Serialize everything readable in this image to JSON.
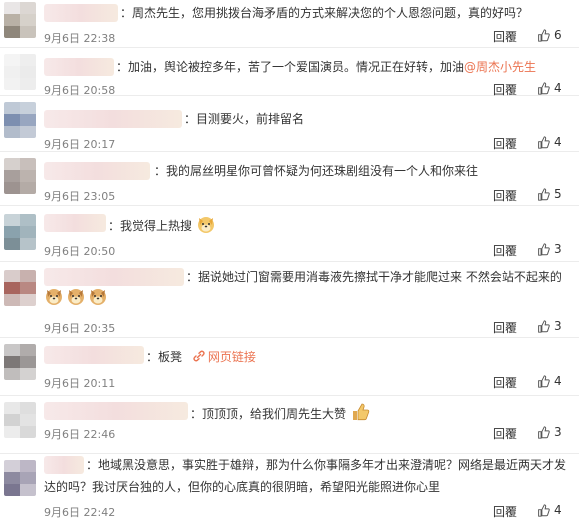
{
  "comments": [
    {
      "text": "：周杰先生，您用挑拨台海矛盾的方式来解决您的个人恩怨问题，真的好吗？",
      "time": "9月6日 22:38",
      "reply": "回覆",
      "likes": "6"
    },
    {
      "text_a": "：加油，舆论被控多年，苦了一个爱国演员。情况正在好转，加油",
      "mention": "@周杰小先生",
      "time": "9月6日 20:58",
      "reply": "回覆",
      "likes": "4"
    },
    {
      "text": "：目测要火，前排留名",
      "time": "9月6日 20:17",
      "reply": "回覆",
      "likes": "4"
    },
    {
      "text": "：我的屌丝明星你可曾怀疑为何还珠剧组没有一个人和你来往",
      "time": "9月6日 23:05",
      "reply": "回覆",
      "likes": "5"
    },
    {
      "text": "：我觉得上热搜",
      "time": "9月6日 20:50",
      "reply": "回覆",
      "likes": "3"
    },
    {
      "text": "：据说她过门窗需要用消毒液先擦拭干净才能爬过来 不然会站不起来的",
      "time": "9月6日 20:35",
      "reply": "回覆",
      "likes": "3"
    },
    {
      "text": "：板凳",
      "link": "网页链接",
      "time": "9月6日 20:11",
      "reply": "回覆",
      "likes": "4"
    },
    {
      "text": "：顶顶顶，给我们周先生大赞",
      "time": "9月6日 22:46",
      "reply": "回覆",
      "likes": "3"
    },
    {
      "text": "：地域黑没意思，事实胜于雄辩，那为什么你事隔多年才出来澄清呢？网络是最近两天才发达的吗？我讨厌台独的人，但你的心底真的很阴暗，希望阳光能照进你心里",
      "time": "9月6日 22:42",
      "reply": "回覆",
      "likes": "4"
    }
  ],
  "colors": {
    "mention": "#eb7350",
    "time": "#808080",
    "divider": "#ececec"
  },
  "icons": {
    "like": "thumbs-up-icon",
    "emoji_dog": "dog-face-emoji",
    "emoji_thumbs": "thumbs-up-emoji",
    "link": "link-icon"
  }
}
